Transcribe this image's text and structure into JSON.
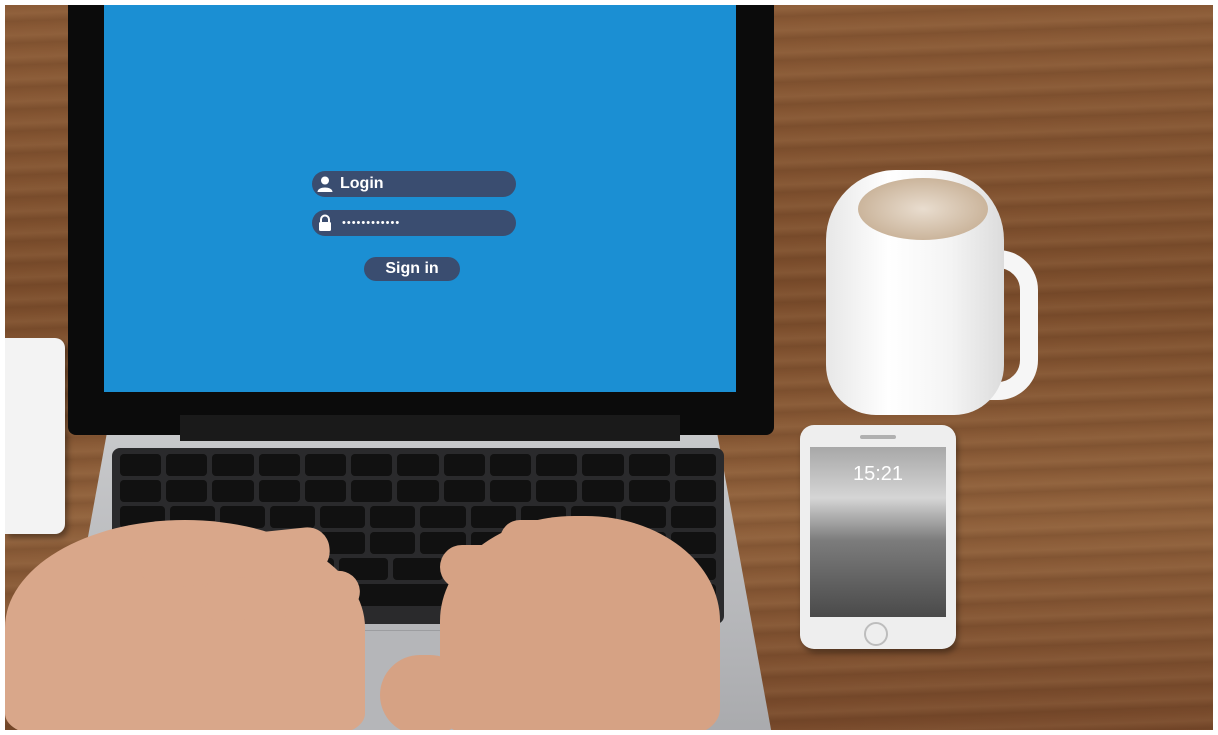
{
  "screen": {
    "login_label": "Login",
    "password_mask": "••••••••••••",
    "signin_label": "Sign in",
    "user_icon": "user-icon",
    "lock_icon": "lock-icon",
    "background_color": "#1b8fd3",
    "field_color": "#3a4d70"
  },
  "phone": {
    "lock_time": "15:21"
  }
}
